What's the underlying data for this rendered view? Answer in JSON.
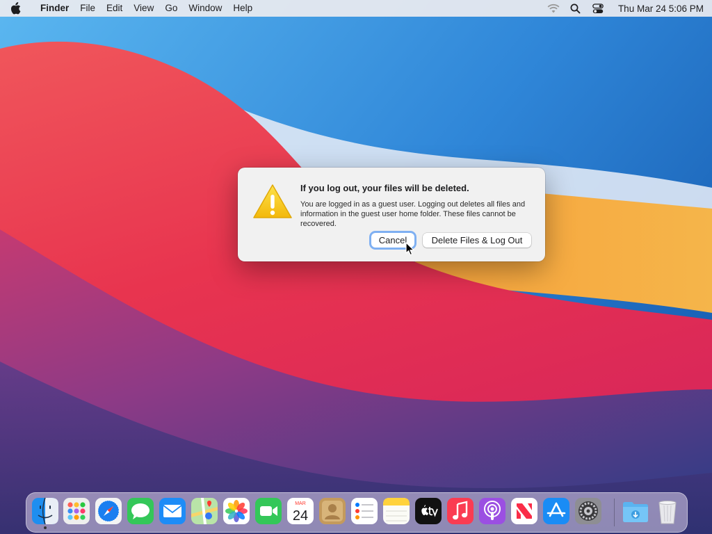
{
  "menubar": {
    "app_name": "Finder",
    "menus": [
      "File",
      "Edit",
      "View",
      "Go",
      "Window",
      "Help"
    ],
    "clock": "Thu Mar 24  5:06 PM",
    "status_icons": [
      "wifi-icon",
      "spotlight-search-icon",
      "control-center-icon"
    ]
  },
  "dialog": {
    "title": "If you log out, your files will be deleted.",
    "message": "You are logged in as a guest user. Logging out deletes all files and information in the guest user home folder. These files cannot be recovered.",
    "cancel_label": "Cancel",
    "confirm_label": "Delete Files & Log Out",
    "icon": "warning-icon",
    "focused_button": "Cancel"
  },
  "dock": {
    "items": [
      "finder-icon",
      "launchpad-icon",
      "safari-icon",
      "messages-icon",
      "mail-icon",
      "maps-icon",
      "photos-icon",
      "facetime-icon",
      "calendar-icon",
      "contacts-icon",
      "reminders-icon",
      "notes-icon",
      "apple-tv-icon",
      "music-icon",
      "podcasts-icon",
      "news-icon",
      "app-store-icon",
      "system-preferences-icon",
      "downloads-folder-icon",
      "trash-icon"
    ],
    "calendar_month": "MAR",
    "calendar_day": "24",
    "running_apps": [
      "Finder"
    ]
  },
  "colors": {
    "dialog_background": "#f1f1f1",
    "focus_ring": "#7fb0f2",
    "warning_yellow": "#f6c90e"
  }
}
